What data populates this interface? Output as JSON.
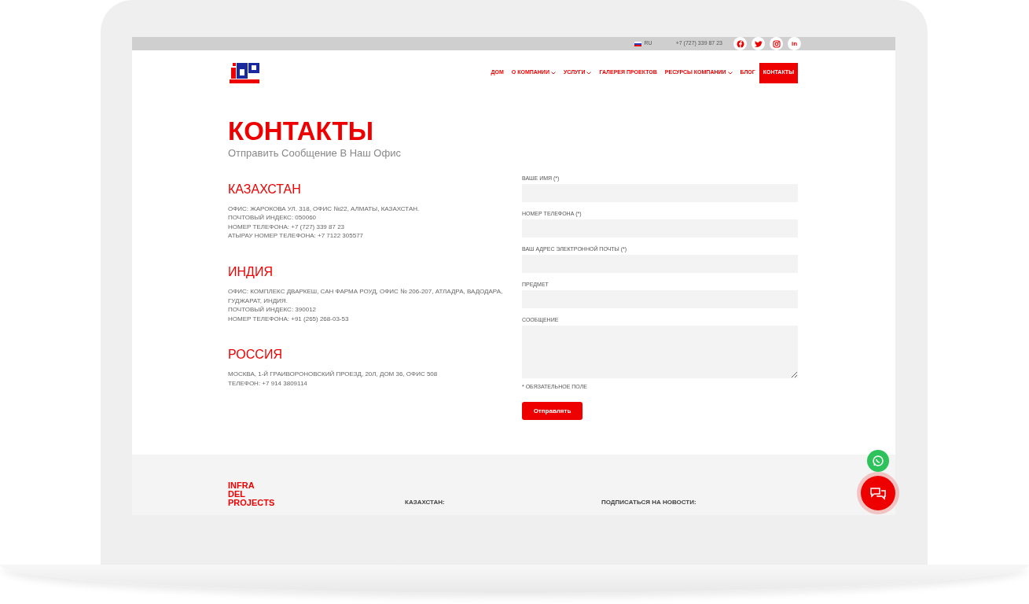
{
  "topbar": {
    "language": "RU",
    "phone": "+7 (727) 339 87 23",
    "social": [
      {
        "kind": "facebook"
      },
      {
        "kind": "twitter"
      },
      {
        "kind": "instagram"
      },
      {
        "kind": "text",
        "label": "in"
      }
    ]
  },
  "nav": [
    {
      "label": "ДОМ",
      "dropdown": false,
      "selected": false
    },
    {
      "label": "О КОМПАНИИ",
      "dropdown": true,
      "selected": false
    },
    {
      "label": "УСЛУГИ",
      "dropdown": true,
      "selected": false
    },
    {
      "label": "ГАЛЕРЕЯ ПРОЕКТОВ",
      "dropdown": false,
      "selected": false
    },
    {
      "label": "РЕСУРСЫ КОМПАНИИ",
      "dropdown": true,
      "selected": false
    },
    {
      "label": "БЛОГ",
      "dropdown": false,
      "selected": false
    },
    {
      "label": "КОНТАКТЫ",
      "dropdown": false,
      "selected": true
    }
  ],
  "page": {
    "title": "КОНТАКТЫ",
    "subtitle": "Отправить Сообщение В Наш Офис"
  },
  "offices": [
    {
      "country": "КАЗАХСТАН",
      "lines": [
        "ОФИС: ЖАРОКОВА УЛ. 318, ОФИС №22, АЛМАТЫ, КАЗАХСТАН.",
        "ПОЧТОВЫЙ ИНДЕКС: 050060",
        "НОМЕР ТЕЛЕФОНА: +7 (727) 339 87 23",
        "АТЫРАУ НОМЕР ТЕЛЕФОНА: +7 7122 305577"
      ]
    },
    {
      "country": "ИНДИЯ",
      "lines": [
        "ОФИС: КОМПЛЕКС ДВАРКЕШ, САН ФАРМА РОУД, ОФИС № 206-207, АТЛАДРА, ВАДОДАРА, ГУДЖАРАТ, ИНДИЯ.",
        "ПОЧТОВЫЙ ИНДЕКС: 390012",
        "НОМЕР ТЕЛЕФОНА: +91 (265) 268-03-53"
      ]
    },
    {
      "country": "РОССИЯ",
      "lines": [
        "МОСКВА, 1-Й ГРАИВОРОНОВСКИЙ ПРОЕЗД, 20Л, ДОМ 36, ОФИС 508",
        "ТЕЛЕФОН: +7 914 3809114"
      ]
    }
  ],
  "form": {
    "fields": [
      {
        "label": "ВАШЕ ИМЯ (*)",
        "kind": "input"
      },
      {
        "label": "НОМЕР ТЕЛЕФОНА (*)",
        "kind": "input"
      },
      {
        "label": "ВАШ АДРЕС ЭЛЕКТРОННОЙ ПОЧТЫ (*)",
        "kind": "input"
      },
      {
        "label": "ПРЕДМЕТ",
        "kind": "input"
      },
      {
        "label": "СООБЩЕНИЕ",
        "kind": "textarea"
      }
    ],
    "note": "* ОБЯЗАТЕЛЬНОЕ ПОЛЕ",
    "submit": "Отправлять"
  },
  "footer": {
    "brand": [
      "INFRA",
      "DEL",
      "PROJECTS"
    ],
    "headings": [
      "КАЗАХСТАН:",
      "ПОДПИСАТЬСЯ НА НОВОСТИ:"
    ]
  }
}
